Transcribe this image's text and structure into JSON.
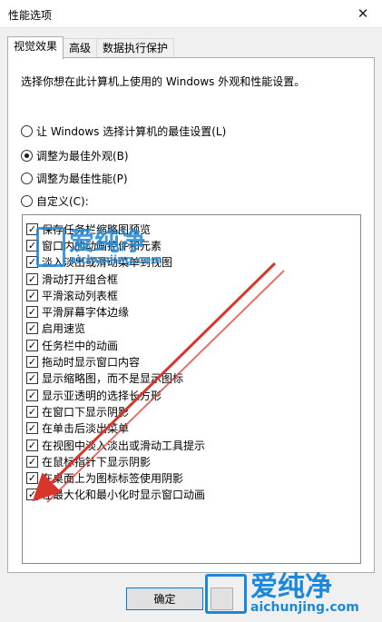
{
  "window": {
    "title": "性能选项",
    "close_glyph": "✕"
  },
  "tabs": [
    {
      "label": "视觉效果",
      "active": true
    },
    {
      "label": "高级",
      "active": false
    },
    {
      "label": "数据执行保护",
      "active": false
    }
  ],
  "panel": {
    "description": "选择你想在此计算机上使用的 Windows 外观和性能设置。"
  },
  "radios": [
    {
      "label": "让 Windows 选择计算机的最佳设置(L)",
      "selected": false
    },
    {
      "label": "调整为最佳外观(B)",
      "selected": true
    },
    {
      "label": "调整为最佳性能(P)",
      "selected": false
    },
    {
      "label": "自定义(C):",
      "selected": false
    }
  ],
  "checkbox_glyph": "✓",
  "options": [
    {
      "label": "保存任务栏缩略图预览",
      "checked": true
    },
    {
      "label": "窗口内的动画控件和元素",
      "checked": true
    },
    {
      "label": "淡入淡出或滑动菜单到视图",
      "checked": true
    },
    {
      "label": "滑动打开组合框",
      "checked": true
    },
    {
      "label": "平滑滚动列表框",
      "checked": true
    },
    {
      "label": "平滑屏幕字体边缘",
      "checked": true
    },
    {
      "label": "启用速览",
      "checked": true
    },
    {
      "label": "任务栏中的动画",
      "checked": true
    },
    {
      "label": "拖动时显示窗口内容",
      "checked": true
    },
    {
      "label": "显示缩略图，而不是显示图标",
      "checked": true
    },
    {
      "label": "显示亚透明的选择长方形",
      "checked": true
    },
    {
      "label": "在窗口下显示阴影",
      "checked": true
    },
    {
      "label": "在单击后淡出菜单",
      "checked": true
    },
    {
      "label": "在视图中淡入淡出或滑动工具提示",
      "checked": true
    },
    {
      "label": "在鼠标指针下显示阴影",
      "checked": true
    },
    {
      "label": "在桌面上为图标标签使用阴影",
      "checked": true
    },
    {
      "label": "在最大化和最小化时显示窗口动画",
      "checked": true
    }
  ],
  "buttons": {
    "ok_label": "确定"
  },
  "watermarks": {
    "cn_text": "爱纯净",
    "en_text": "aichunjing.com",
    "color": "#1e88d8"
  },
  "annotation_color": "#d9352b"
}
